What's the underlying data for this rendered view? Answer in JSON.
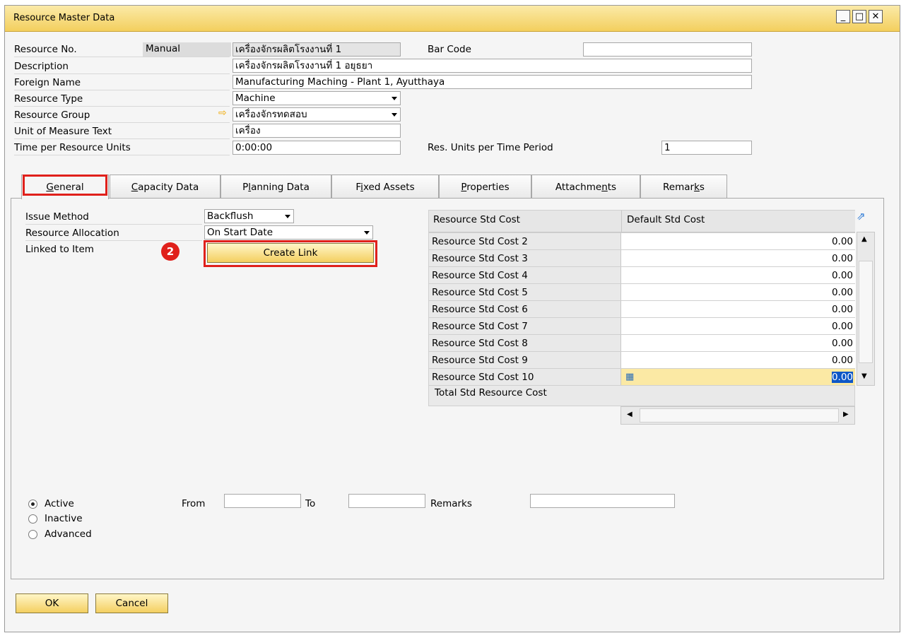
{
  "window": {
    "title": "Resource Master Data"
  },
  "header": {
    "resource_no_label": "Resource No.",
    "resource_no_series": "Manual",
    "resource_no_value": "เครื่องจักรผลิตโรงงานที่ 1",
    "bar_code_label": "Bar Code",
    "bar_code_value": "",
    "description_label": "Description",
    "description_value": "เครื่องจักรผลิตโรงงานที่ 1 อยุธยา",
    "foreign_name_label": "Foreign Name",
    "foreign_name_value": "Manufacturing Maching - Plant 1, Ayutthaya",
    "resource_type_label": "Resource Type",
    "resource_type_value": "Machine",
    "resource_group_label": "Resource Group",
    "resource_group_value": "เครื่องจักรทดสอบ",
    "uom_label": "Unit of Measure Text",
    "uom_value": "เครื่อง",
    "time_per_unit_label": "Time per Resource Units",
    "time_per_unit_value": "0:00:00",
    "res_units_label": "Res. Units per Time Period",
    "res_units_value": "1"
  },
  "tabs": [
    {
      "pre": "",
      "u": "G",
      "post": "eneral"
    },
    {
      "pre": "",
      "u": "C",
      "post": "apacity Data"
    },
    {
      "pre": "P",
      "u": "l",
      "post": "anning Data"
    },
    {
      "pre": "F",
      "u": "i",
      "post": "xed Assets"
    },
    {
      "pre": "",
      "u": "P",
      "post": "roperties"
    },
    {
      "pre": "Attachme",
      "u": "n",
      "post": "ts"
    },
    {
      "pre": "Remar",
      "u": "k",
      "post": "s"
    }
  ],
  "general": {
    "issue_method_label": "Issue Method",
    "issue_method_value": "Backflush",
    "allocation_label": "Resource Allocation",
    "allocation_value": "On Start Date",
    "linked_label": "Linked to Item",
    "create_link_label": "Create Link",
    "step_badge": "2"
  },
  "cost_grid": {
    "col1": "Resource Std Cost",
    "col2": "Default Std Cost",
    "rows": [
      {
        "label": "Resource Std Cost 2",
        "value": "0.00"
      },
      {
        "label": "Resource Std Cost 3",
        "value": "0.00"
      },
      {
        "label": "Resource Std Cost 4",
        "value": "0.00"
      },
      {
        "label": "Resource Std Cost 5",
        "value": "0.00"
      },
      {
        "label": "Resource Std Cost 6",
        "value": "0.00"
      },
      {
        "label": "Resource Std Cost 7",
        "value": "0.00"
      },
      {
        "label": "Resource Std Cost 8",
        "value": "0.00"
      },
      {
        "label": "Resource Std Cost 9",
        "value": "0.00"
      },
      {
        "label": "Resource Std Cost 10",
        "value": "0.00"
      }
    ],
    "total_label": "Total Std Resource Cost"
  },
  "status": {
    "active": "Active",
    "inactive": "Inactive",
    "advanced": "Advanced",
    "from_label": "From",
    "to_label": "To",
    "remarks_label": "Remarks"
  },
  "footer": {
    "ok": "OK",
    "cancel": "Cancel"
  },
  "colors": {
    "highlight": "#e0201b",
    "titlebar": "#f3cf5e",
    "selected_row": "#fbe9a4",
    "selected_value": "#0e57c7"
  }
}
